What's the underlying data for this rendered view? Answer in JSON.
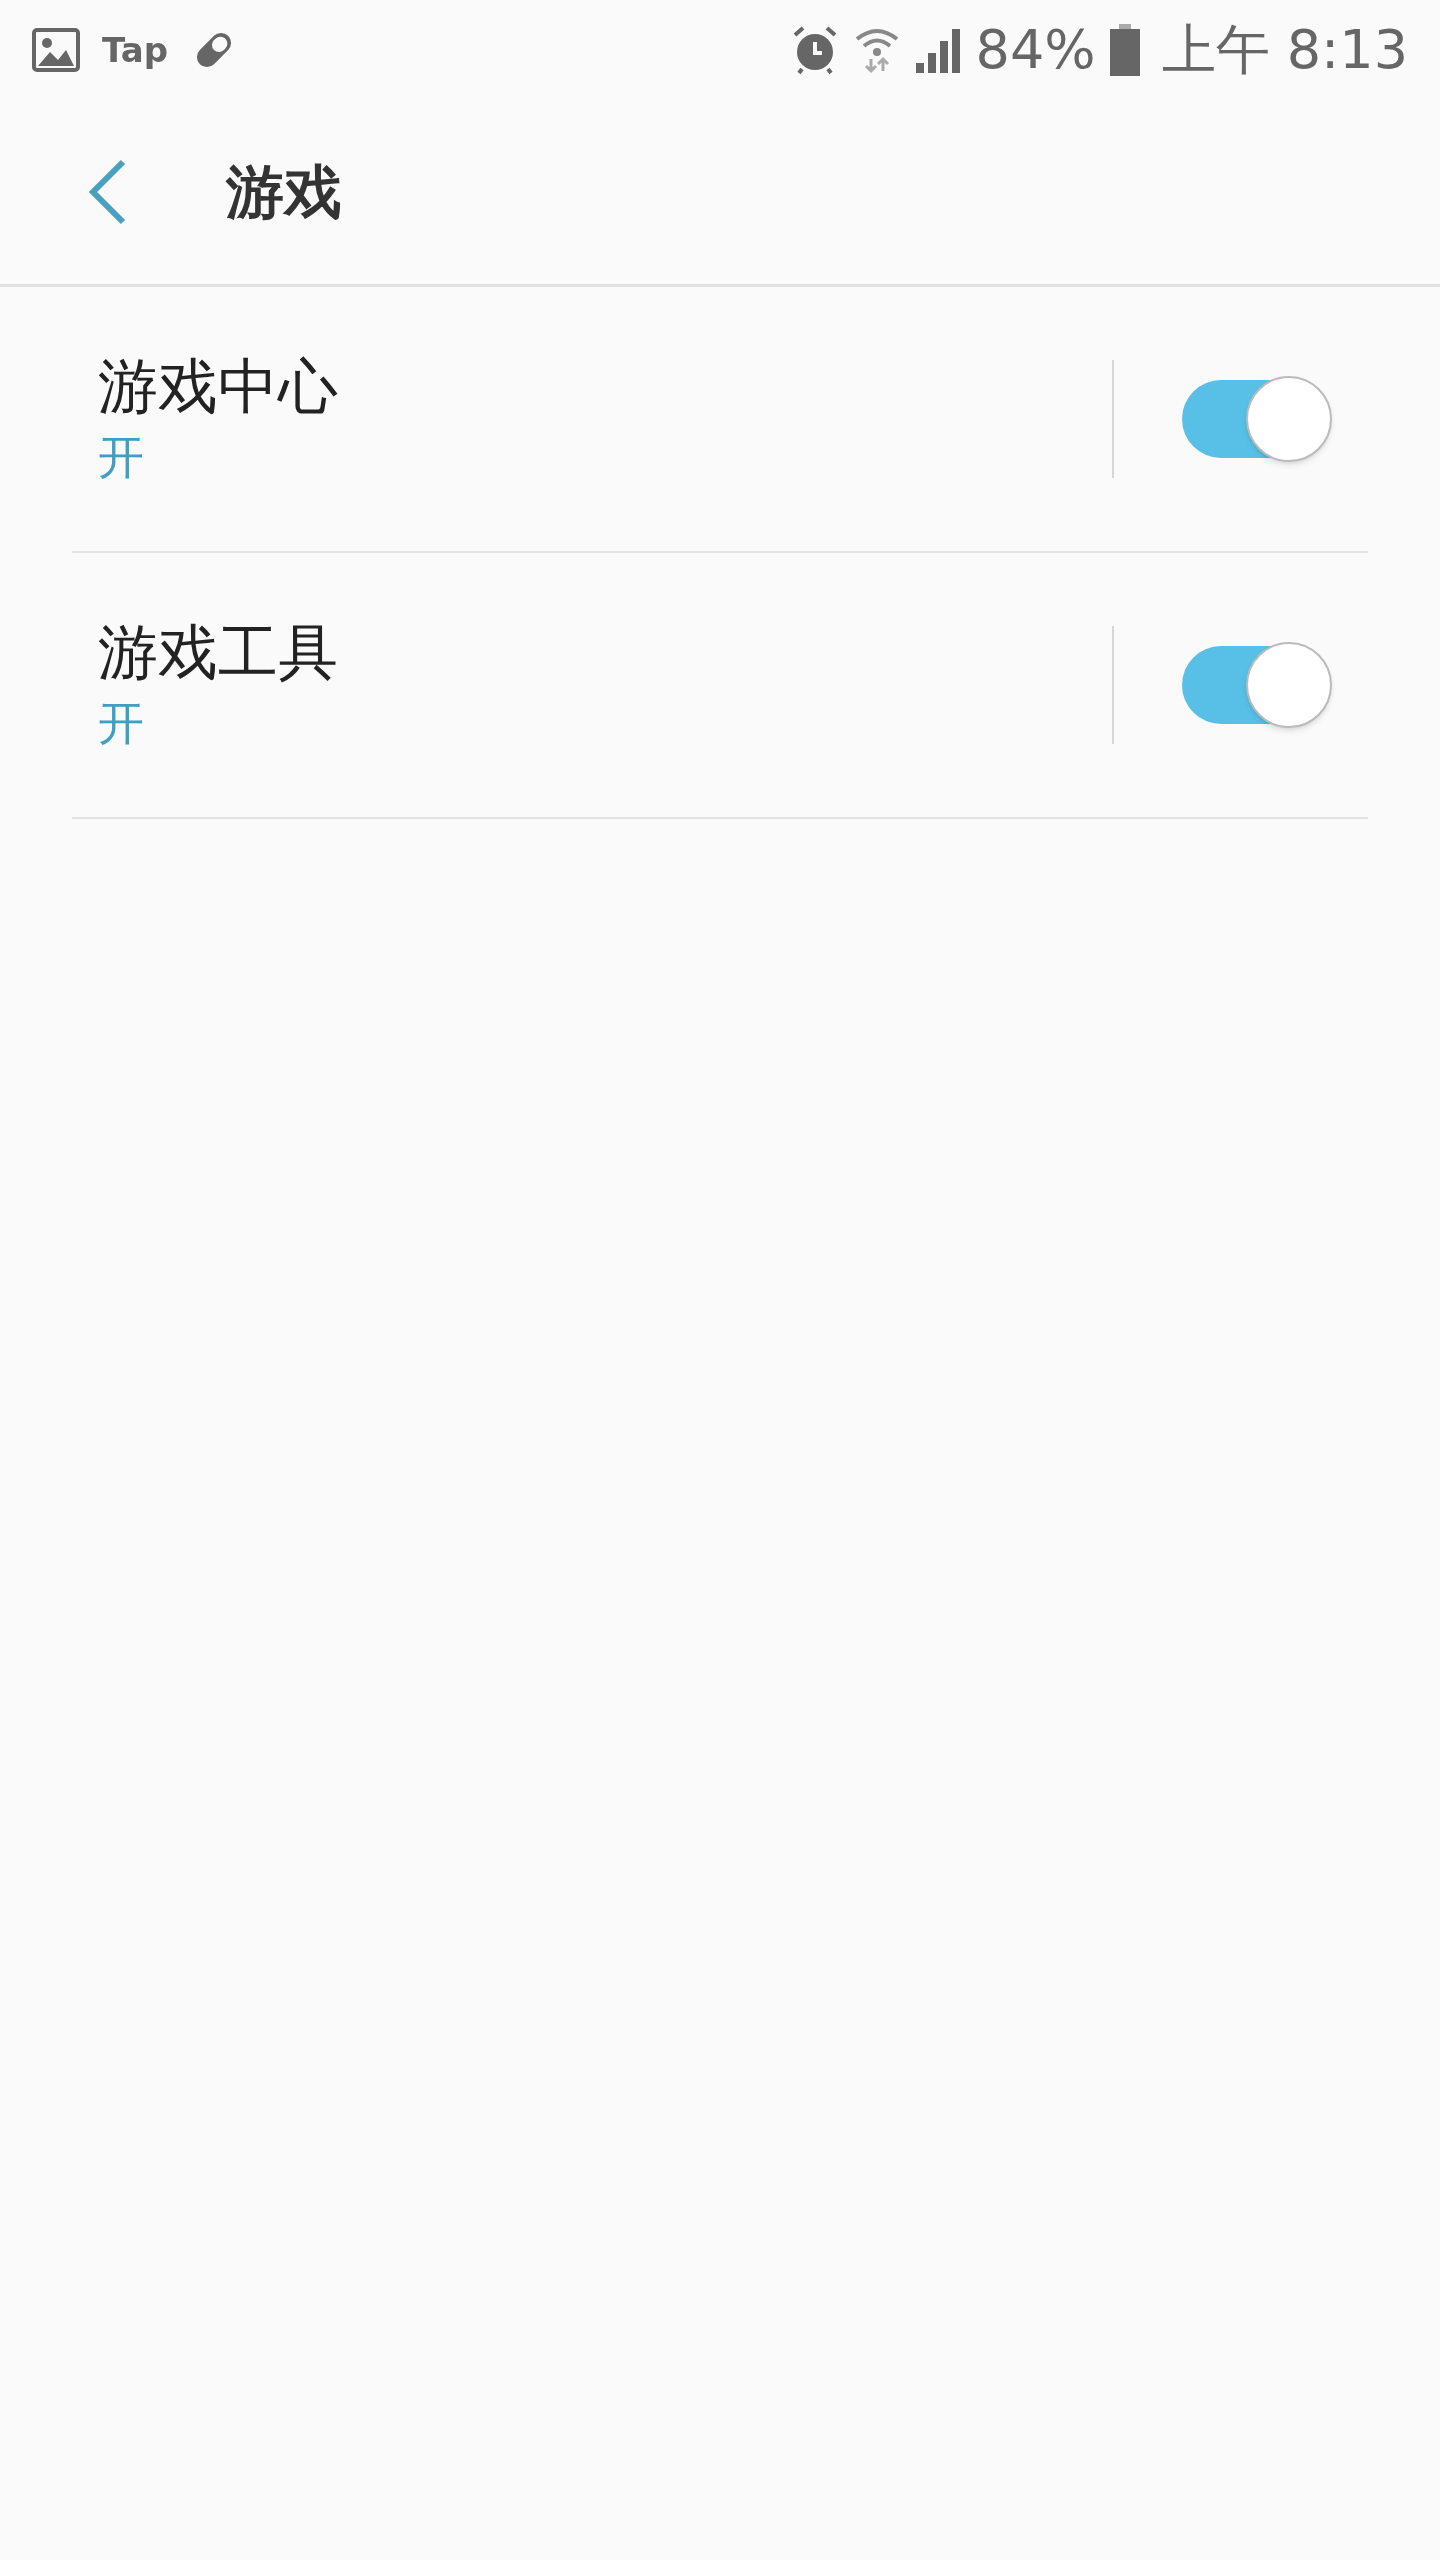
{
  "status_bar": {
    "app_label": "Tap",
    "battery": "84%",
    "time": "上午 8:13"
  },
  "header": {
    "title": "游戏"
  },
  "settings": [
    {
      "title": "游戏中心",
      "status": "开",
      "on": true
    },
    {
      "title": "游戏工具",
      "status": "开",
      "on": true
    }
  ]
}
